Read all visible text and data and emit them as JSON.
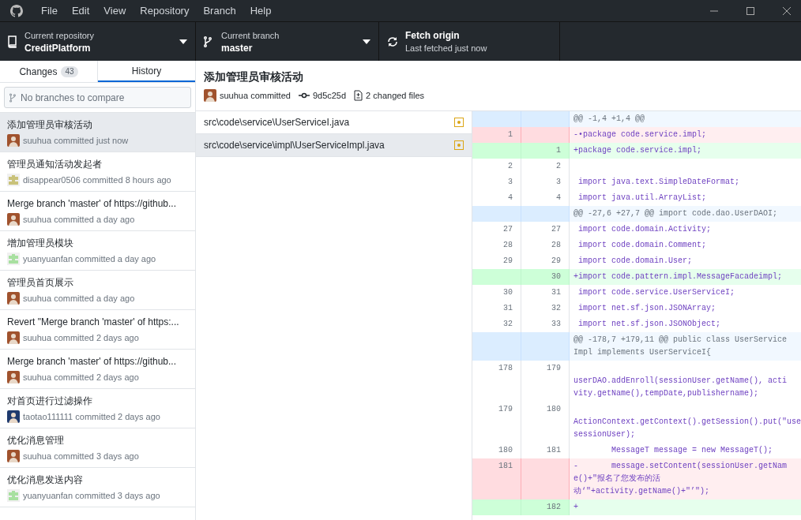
{
  "menu": [
    "File",
    "Edit",
    "View",
    "Repository",
    "Branch",
    "Help"
  ],
  "toolbar": {
    "repository": {
      "label": "Current repository",
      "value": "CreditPlatform"
    },
    "branch": {
      "label": "Current branch",
      "value": "master"
    },
    "fetch": {
      "label": "Fetch origin",
      "value": "Last fetched just now"
    }
  },
  "tabs": [
    {
      "label": "Changes",
      "count": "43",
      "selected": false
    },
    {
      "label": "History",
      "selected": true
    }
  ],
  "compare": {
    "placeholder": "No branches to compare"
  },
  "commits": [
    {
      "title": "添加管理员审核活动",
      "meta": "suuhua committed just now",
      "avatar": {
        "kind": "photo",
        "color": "#a0522d"
      },
      "selected": true
    },
    {
      "title": "管理员通知活动发起者",
      "meta": "disappear0506 committed 8 hours ago",
      "avatar": {
        "kind": "identicon",
        "color": "#c9c27a"
      },
      "selected": false
    },
    {
      "title": "Merge branch 'master' of https://github...",
      "meta": "suuhua committed a day ago",
      "avatar": {
        "kind": "photo",
        "color": "#a0522d"
      },
      "selected": false
    },
    {
      "title": "增加管理员模块",
      "meta": "yuanyuanfan committed a day ago",
      "avatar": {
        "kind": "identicon",
        "color": "#a8e0a0"
      },
      "selected": false
    },
    {
      "title": "管理员首页展示",
      "meta": "suuhua committed a day ago",
      "avatar": {
        "kind": "photo",
        "color": "#a0522d"
      },
      "selected": false
    },
    {
      "title": "Revert \"Merge branch 'master' of https:...",
      "meta": "suuhua committed 2 days ago",
      "avatar": {
        "kind": "photo",
        "color": "#a0522d"
      },
      "selected": false
    },
    {
      "title": "Merge branch 'master' of https://github...",
      "meta": "suuhua committed 2 days ago",
      "avatar": {
        "kind": "photo",
        "color": "#a0522d"
      },
      "selected": false
    },
    {
      "title": "对首页进行过滤操作",
      "meta": "taotao111111 committed 2 days ago",
      "avatar": {
        "kind": "photo",
        "color": "#1e3a6e"
      },
      "selected": false
    },
    {
      "title": "优化消息管理",
      "meta": "suuhua committed 3 days ago",
      "avatar": {
        "kind": "photo",
        "color": "#a0522d"
      },
      "selected": false
    },
    {
      "title": "优化消息发送内容",
      "meta": "yuanyuanfan committed 3 days ago",
      "avatar": {
        "kind": "identicon",
        "color": "#a8e0a0"
      },
      "selected": false
    }
  ],
  "commit": {
    "title": "添加管理员审核活动",
    "author": "suuhua committed",
    "sha": "9d5c25d",
    "files_changed": "2 changed files"
  },
  "files": [
    {
      "path": "src\\code\\service\\UserServiceI.java",
      "modified": true,
      "selected": false
    },
    {
      "path": "src\\code\\service\\impl\\UserServiceImpl.java",
      "modified": true,
      "selected": true
    }
  ],
  "diff": [
    {
      "kind": "hunk",
      "lines": [
        "@@ -1,4 +1,4 @@"
      ]
    },
    {
      "kind": "del",
      "old": "1",
      "lines": [
        "-•package code.service.impl;"
      ]
    },
    {
      "kind": "add",
      "new": "1",
      "lines": [
        "+package code.service.impl;"
      ]
    },
    {
      "kind": "context",
      "old": "2",
      "new": "2"
    },
    {
      "kind": "context",
      "old": "3",
      "new": "3",
      "lines": [
        " import java.text.SimpleDateFormat;"
      ]
    },
    {
      "kind": "context",
      "old": "4",
      "new": "4",
      "lines": [
        " import java.util.ArrayList;"
      ]
    },
    {
      "kind": "hunk",
      "lines": [
        "@@ -27,6 +27,7 @@ import code.dao.UserDAOI;"
      ]
    },
    {
      "kind": "context",
      "old": "27",
      "new": "27",
      "lines": [
        " import code.domain.Activity;"
      ]
    },
    {
      "kind": "context",
      "old": "28",
      "new": "28",
      "lines": [
        " import code.domain.Comment;"
      ]
    },
    {
      "kind": "context",
      "old": "29",
      "new": "29",
      "lines": [
        " import code.domain.User;"
      ]
    },
    {
      "kind": "add",
      "new": "30",
      "lines": [
        "+import code.pattern.impl.MessageFacadeimpl;"
      ]
    },
    {
      "kind": "context",
      "old": "30",
      "new": "31",
      "lines": [
        " import code.service.UserServiceI;"
      ]
    },
    {
      "kind": "context",
      "old": "31",
      "new": "32",
      "lines": [
        " import net.sf.json.JSONArray;"
      ]
    },
    {
      "kind": "context",
      "old": "32",
      "new": "33",
      "lines": [
        " import net.sf.json.JSONObject;"
      ]
    },
    {
      "kind": "hunk",
      "lines": [
        "@@ -178,7 +179,11 @@ public class UserService",
        "Impl implements UserServiceI{"
      ]
    },
    {
      "kind": "context",
      "old": "178",
      "new": "179",
      "blank_first": true,
      "lines": [
        "userDAO.addEnroll(sessionUser.getName(), acti",
        "vity.getName(),tempDate,publishername);"
      ]
    },
    {
      "kind": "context",
      "old": "179",
      "new": "180",
      "blank_first": true,
      "lines": [
        "ActionContext.getContext().getSession().put(\"use",
        "sessionUser);"
      ]
    },
    {
      "kind": "context",
      "old": "180",
      "new": "181",
      "lines": [
        "        MessageT message = new MessageT();"
      ]
    },
    {
      "kind": "del",
      "old": "181",
      "lines": [
        "-       message.setContent(sessionUser.getNam",
        "e()+\"报名了您发布的活",
        "动‘\"+activity.getName()+\"’\");"
      ]
    },
    {
      "kind": "add",
      "new": "182",
      "lines": [
        "+"
      ]
    }
  ]
}
